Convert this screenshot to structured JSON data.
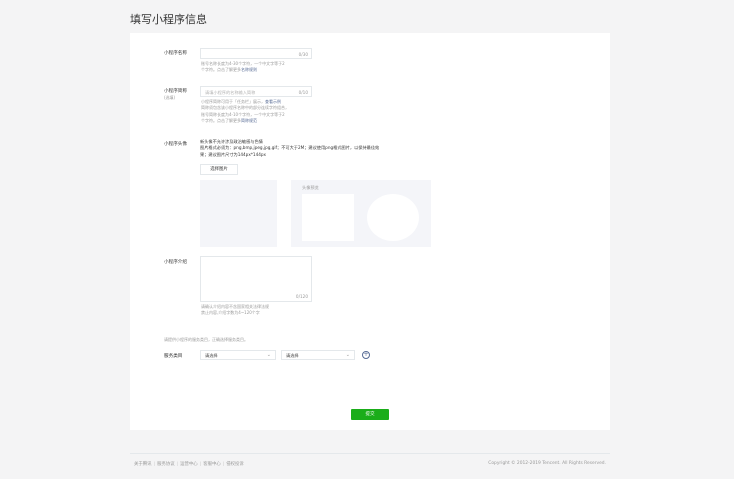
{
  "page_title": "填写小程序信息",
  "name_field": {
    "label": "小程序名称",
    "counter": "0/30",
    "tip_line1": "账号名称长度为4-30个字符，一个中文字等于2",
    "tip_line2": "个字符。点击了解更多",
    "tip_link": "名称规则"
  },
  "short_name_field": {
    "label": "小程序简称",
    "sublabel": "(选填)",
    "placeholder": "请填小程序的名称输入简称",
    "counter": "0/10",
    "tip_line1_a": "小程序简称可用于「任务栏」展示，",
    "tip_line1_link": "查看示例",
    "tip_line2": "简称须包含该小程序名称中的部分连续字符组合，",
    "tip_line3": "账号简称长度为4-10个字符，一个中文字等于2",
    "tip_line4_a": "个字符。点击了解更多",
    "tip_line4_link": "简称规范"
  },
  "avatar_field": {
    "label": "小程序头像",
    "desc_line1": "新头像不允许涉及政治敏感与色情",
    "desc_line2": "图片格式必须为：png,bmp,jpeg,jpg,gif；不可大于2M；建议使用png格式图片，以保持最佳效",
    "desc_line3": "果；建议图片尺寸为144px*144px",
    "upload_button": "选择图片",
    "preview_title": "头像预览"
  },
  "intro_field": {
    "label": "小程序介绍",
    "counter": "0/120",
    "tip_line1": "请确认介绍内容不含国家相关法律法规",
    "tip_line2": "禁止内容,介绍字数为4~120个字"
  },
  "category_field": {
    "notice": "请提供小程序的服务类目，正确选择服务类目。",
    "label": "服务类目",
    "first_select": "请选择",
    "second_select": "请选择"
  },
  "submit_label": "提交",
  "footer": {
    "links": [
      "关于腾讯",
      "服务协议",
      "运营中心",
      "客服中心",
      "侵权投诉"
    ],
    "copyright": "Copyright © 2012-2019 Tencent. All Rights Reserved."
  },
  "colors": {
    "accent_green": "#1aad19",
    "link_blue": "#576b95"
  }
}
